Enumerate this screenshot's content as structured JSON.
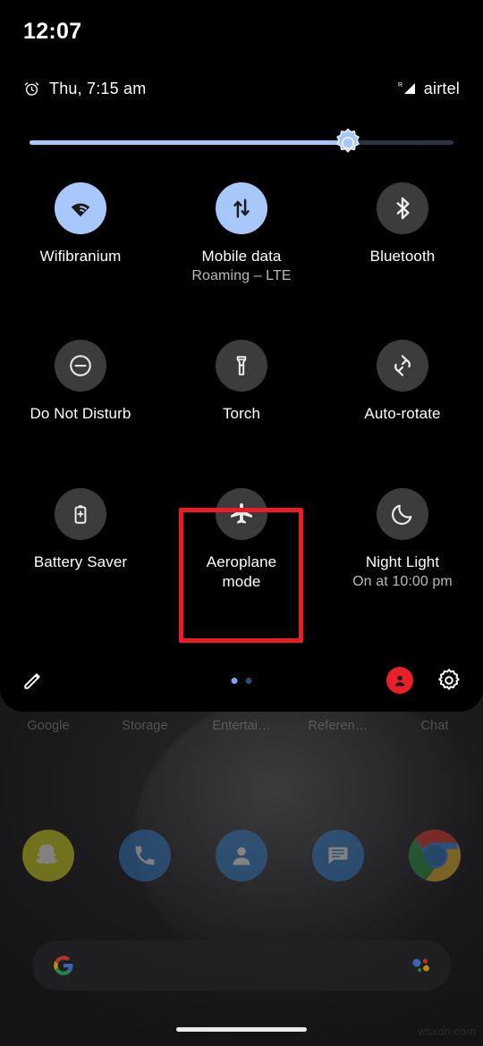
{
  "status_bar": {
    "time": "12:07",
    "alarm_icon": "alarm-clock-icon",
    "alarm_text": "Thu, 7:15 am",
    "roaming_indicator": "R",
    "signal_icon": "signal-bars-icon",
    "carrier": "airtel"
  },
  "brightness": {
    "label": "brightness-slider",
    "value_percent": 75,
    "thumb_icon": "sun-brightness-icon",
    "fill_color": "#A8C7FA",
    "track_color": "#2E3340"
  },
  "tiles": [
    {
      "name": "wifi",
      "label": "Wifibranium",
      "sub": "",
      "icon": "wifi-icon",
      "state": "on"
    },
    {
      "name": "mobile-data",
      "label": "Mobile data",
      "sub": "Roaming – LTE",
      "icon": "mobile-data-arrows-icon",
      "state": "on"
    },
    {
      "name": "bluetooth",
      "label": "Bluetooth",
      "sub": "",
      "icon": "bluetooth-icon",
      "state": "off"
    },
    {
      "name": "do-not-disturb",
      "label": "Do Not Disturb",
      "sub": "",
      "icon": "do-not-disturb-icon",
      "state": "off"
    },
    {
      "name": "torch",
      "label": "Torch",
      "sub": "",
      "icon": "flashlight-icon",
      "state": "off"
    },
    {
      "name": "auto-rotate",
      "label": "Auto-rotate",
      "sub": "",
      "icon": "auto-rotate-icon",
      "state": "off"
    },
    {
      "name": "battery-saver",
      "label": "Battery Saver",
      "sub": "",
      "icon": "battery-saver-icon",
      "state": "off"
    },
    {
      "name": "aeroplane-mode",
      "label": "Aeroplane mode",
      "sub": "",
      "icon": "airplane-icon",
      "state": "off",
      "highlighted": true
    },
    {
      "name": "night-light",
      "label": "Night Light",
      "sub": "On at 10:00 pm",
      "icon": "crescent-moon-icon",
      "state": "off"
    }
  ],
  "highlight": {
    "target": "aeroplane-mode",
    "color": "#ED1C24"
  },
  "footer": {
    "edit_icon": "pencil-edit-icon",
    "pages_total": 2,
    "page_active": 1,
    "user_icon": "user-avatar-icon",
    "user_color": "#E8202A",
    "settings_icon": "gear-settings-icon"
  },
  "home_screen": {
    "folders": [
      {
        "label": "Google"
      },
      {
        "label": "Storage"
      },
      {
        "label": "Entertai…"
      },
      {
        "label": "Referen…"
      },
      {
        "label": "Chat"
      }
    ],
    "dock": [
      {
        "name": "snapchat",
        "icon": "snapchat-ghost-icon",
        "color": "#C8C820"
      },
      {
        "name": "phone",
        "icon": "phone-handset-icon",
        "color": "#2F6FB0"
      },
      {
        "name": "contacts",
        "icon": "contacts-person-icon",
        "color": "#2F6FB0"
      },
      {
        "name": "messages",
        "icon": "messages-bubble-icon",
        "color": "#2F6FB0"
      },
      {
        "name": "chrome",
        "icon": "chrome-browser-icon",
        "color": "#3B7DD8"
      }
    ],
    "search": {
      "google_icon": "google-g-icon",
      "assistant_icon": "google-assistant-icon",
      "placeholder": ""
    },
    "gesture_bar": "home-gesture-bar",
    "watermark": "wsxdn.com"
  }
}
